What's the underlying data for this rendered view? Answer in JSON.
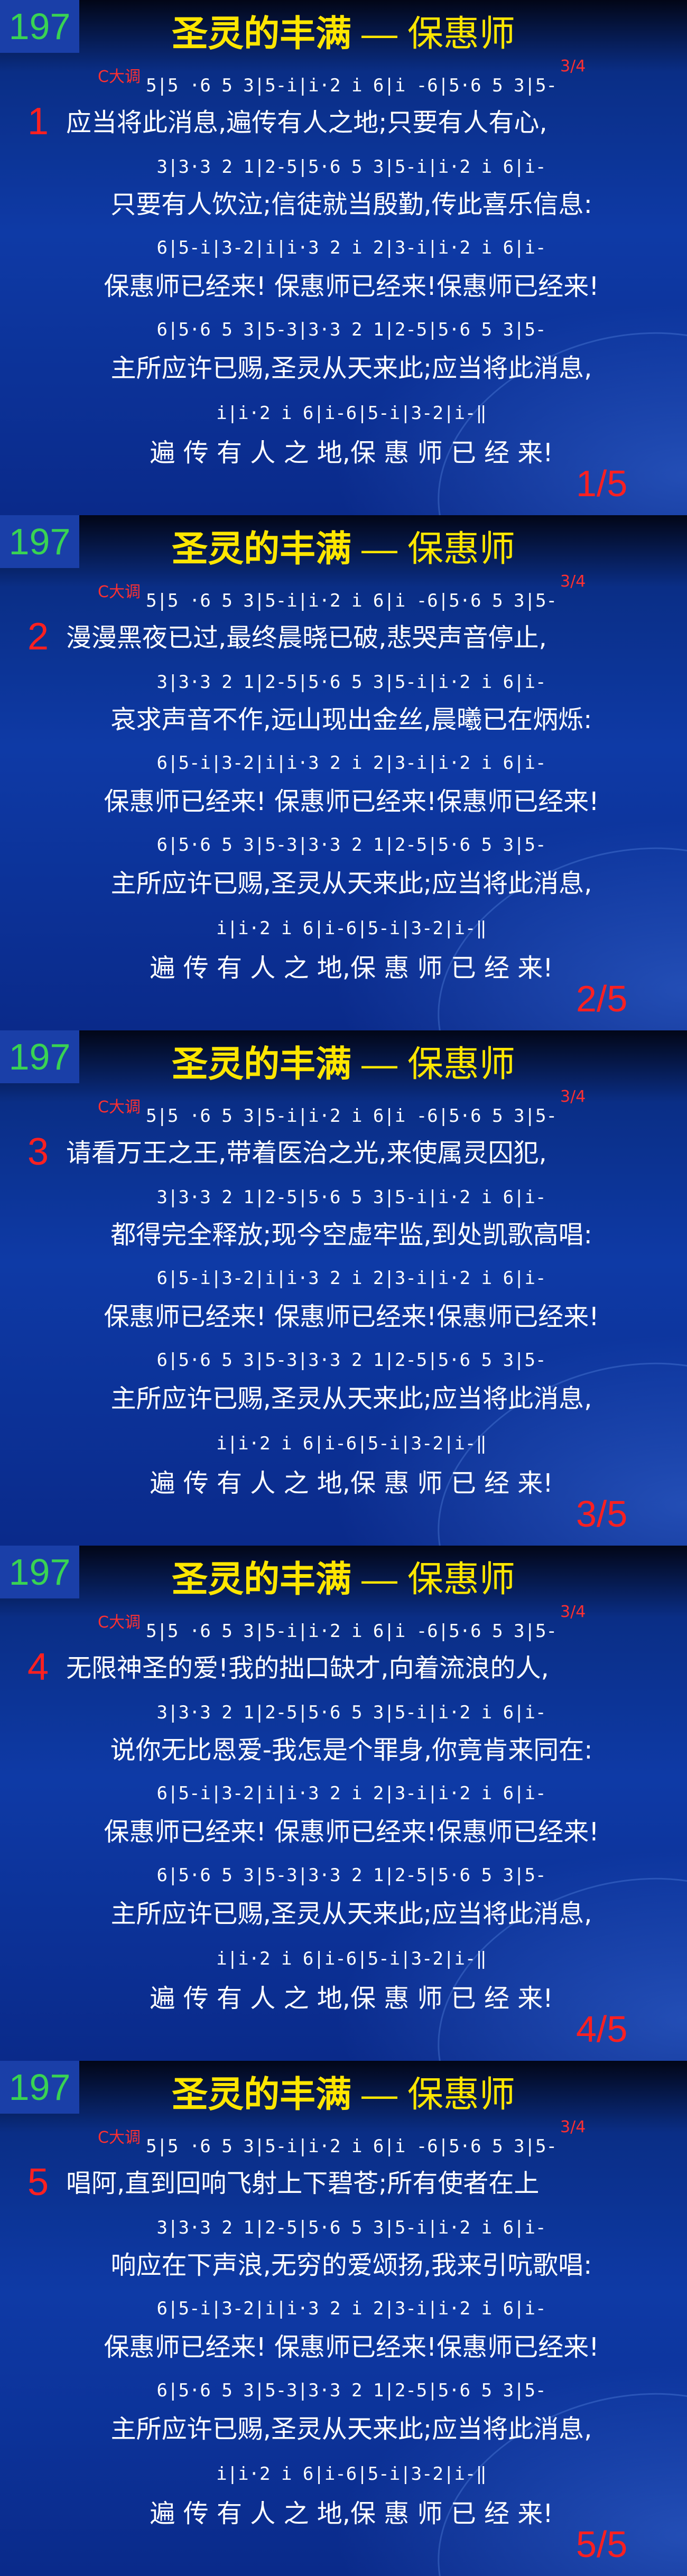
{
  "hymn_number": "197",
  "title_main": "圣灵的丰满",
  "title_sub": " — 保惠师",
  "key": "C大调",
  "time": "3/4",
  "notation": [
    "5|5 ·6 5 3|5-i|i·2 i 6|i -6|5·6 5 3|5-",
    "3|3·3 2 1|2-5|5·6 5 3|5-i|i·2 i 6|i-",
    "6|5-i|3-2|i|i·3 2 i 2|3-i|i·2 i 6|i-",
    "6|5·6 5 3|5-3|3·3 2 1|2-5|5·6 5 3|5-",
    "i|i·2 i 6|i-6|5-i|3-2|i-‖"
  ],
  "common_lyrics": [
    "保惠师已经来! 保惠师已经来!保惠师已经来!",
    "主所应许已赐,圣灵从天来此;应当将此消息,",
    "遍 传 有 人 之 地,保 惠 师 已 经 来!"
  ],
  "slides": [
    {
      "verse": "1",
      "page": "1/5",
      "line1": "应当将此消息,遍传有人之地;只要有人有心,",
      "line2": "只要有人饮泣;信徒就当殷勤,传此喜乐信息:"
    },
    {
      "verse": "2",
      "page": "2/5",
      "line1": "漫漫黑夜已过,最终晨晓已破,悲哭声音停止,",
      "line2": "哀求声音不作,远山现出金丝,晨曦已在炳烁:"
    },
    {
      "verse": "3",
      "page": "3/5",
      "line1": "请看万王之王,带着医治之光,来使属灵囚犯,",
      "line2": "都得完全释放;现今空虚牢监,到处凯歌高唱:"
    },
    {
      "verse": "4",
      "page": "4/5",
      "line1": "无限神圣的爱!我的拙口缺才,向着流浪的人,",
      "line2": "说你无比恩爱-我怎是个罪身,你竟肯来同在:"
    },
    {
      "verse": "5",
      "page": "5/5",
      "line1": "唱阿,直到回响飞射上下碧苍;所有使者在上",
      "line2": "响应在下声浪,无穷的爱颂扬,我来引吭歌唱:"
    }
  ]
}
